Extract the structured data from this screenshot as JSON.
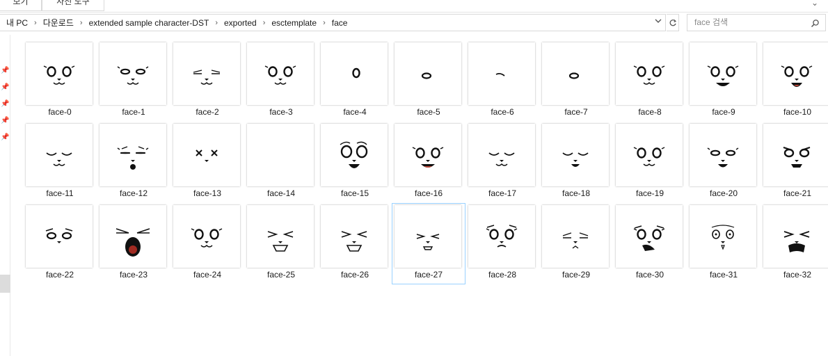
{
  "ribbon": {
    "tab_view": "보기",
    "tab_picture_tools": "사진 도구",
    "expand_icon": "chevron-down-icon"
  },
  "address": {
    "crumbs": [
      "내 PC",
      "다운로드",
      "extended sample character-DST",
      "exported",
      "esctemplate",
      "face"
    ],
    "dropdown_icon": "chevron-down-icon",
    "refresh_icon": "refresh-icon"
  },
  "search": {
    "placeholder": "face 검색",
    "icon": "search-icon"
  },
  "nav": {
    "pins": 5
  },
  "files": [
    {
      "name": "face-0",
      "expr": "normal"
    },
    {
      "name": "face-1",
      "expr": "narrow"
    },
    {
      "name": "face-2",
      "expr": "squint"
    },
    {
      "name": "face-3",
      "expr": "normal"
    },
    {
      "name": "face-4",
      "expr": "side"
    },
    {
      "name": "face-5",
      "expr": "side-narrow"
    },
    {
      "name": "face-6",
      "expr": "side-closed"
    },
    {
      "name": "face-7",
      "expr": "side-narrow"
    },
    {
      "name": "face-8",
      "expr": "normal"
    },
    {
      "name": "face-9",
      "expr": "smile"
    },
    {
      "name": "face-10",
      "expr": "open"
    },
    {
      "name": "face-11",
      "expr": "closed"
    },
    {
      "name": "face-12",
      "expr": "worried"
    },
    {
      "name": "face-13",
      "expr": "x-eyes"
    },
    {
      "name": "face-14",
      "expr": "blank"
    },
    {
      "name": "face-15",
      "expr": "shock"
    },
    {
      "name": "face-16",
      "expr": "grin"
    },
    {
      "name": "face-17",
      "expr": "closed"
    },
    {
      "name": "face-18",
      "expr": "closed-smile"
    },
    {
      "name": "face-19",
      "expr": "normal"
    },
    {
      "name": "face-20",
      "expr": "worried-open"
    },
    {
      "name": "face-21",
      "expr": "angry"
    },
    {
      "name": "face-22",
      "expr": "annoyed"
    },
    {
      "name": "face-23",
      "expr": "scream"
    },
    {
      "name": "face-24",
      "expr": "normal"
    },
    {
      "name": "face-25",
      "expr": "pain"
    },
    {
      "name": "face-26",
      "expr": "pain"
    },
    {
      "name": "face-27",
      "expr": "pain-small",
      "selected": true
    },
    {
      "name": "face-28",
      "expr": "annoyed-big"
    },
    {
      "name": "face-29",
      "expr": "squint-sad"
    },
    {
      "name": "face-30",
      "expr": "angry-grit"
    },
    {
      "name": "face-31",
      "expr": "tiny-surprise"
    },
    {
      "name": "face-32",
      "expr": "pain-open"
    }
  ]
}
